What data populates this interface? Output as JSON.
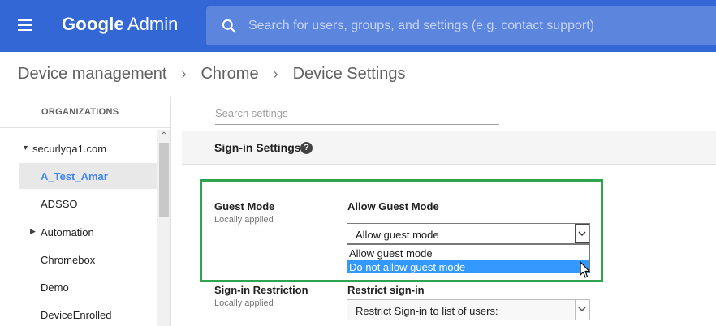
{
  "app": {
    "brand": "Google",
    "product": "Admin",
    "search_placeholder": "Search for users, groups, and settings (e.g. contact support)"
  },
  "breadcrumb": [
    "Device management",
    "Chrome",
    "Device Settings"
  ],
  "orgs": {
    "title": "ORGANIZATIONS",
    "items": [
      {
        "label": "securlyqa1.com",
        "expanded": true
      },
      {
        "label": "A_Test_Amar",
        "selected": true
      },
      {
        "label": "ADSSO"
      },
      {
        "label": "Automation",
        "collapsed": true
      },
      {
        "label": "Chromebox"
      },
      {
        "label": "Demo"
      },
      {
        "label": "DeviceEnrolled"
      }
    ]
  },
  "settings": {
    "search_placeholder": "Search settings",
    "section_title": "Sign-in Settings",
    "guest_mode": {
      "name": "Guest Mode",
      "sub": "Locally applied",
      "field_title": "Allow Guest Mode",
      "selected": "Allow guest mode",
      "options": [
        "Allow guest mode",
        "Do not allow guest mode"
      ],
      "hovered_index": 1
    },
    "signin_restriction": {
      "name": "Sign-in Restriction",
      "sub": "Locally applied",
      "field_title": "Restrict sign-in",
      "selected": "Restrict Sign-in to list of users:"
    }
  },
  "colors": {
    "topbar": "#3367d6",
    "searchbox": "#5c85de",
    "highlight": "#2ea44f",
    "selected_org": "#4285f4",
    "option_hover": "#3399ff"
  }
}
